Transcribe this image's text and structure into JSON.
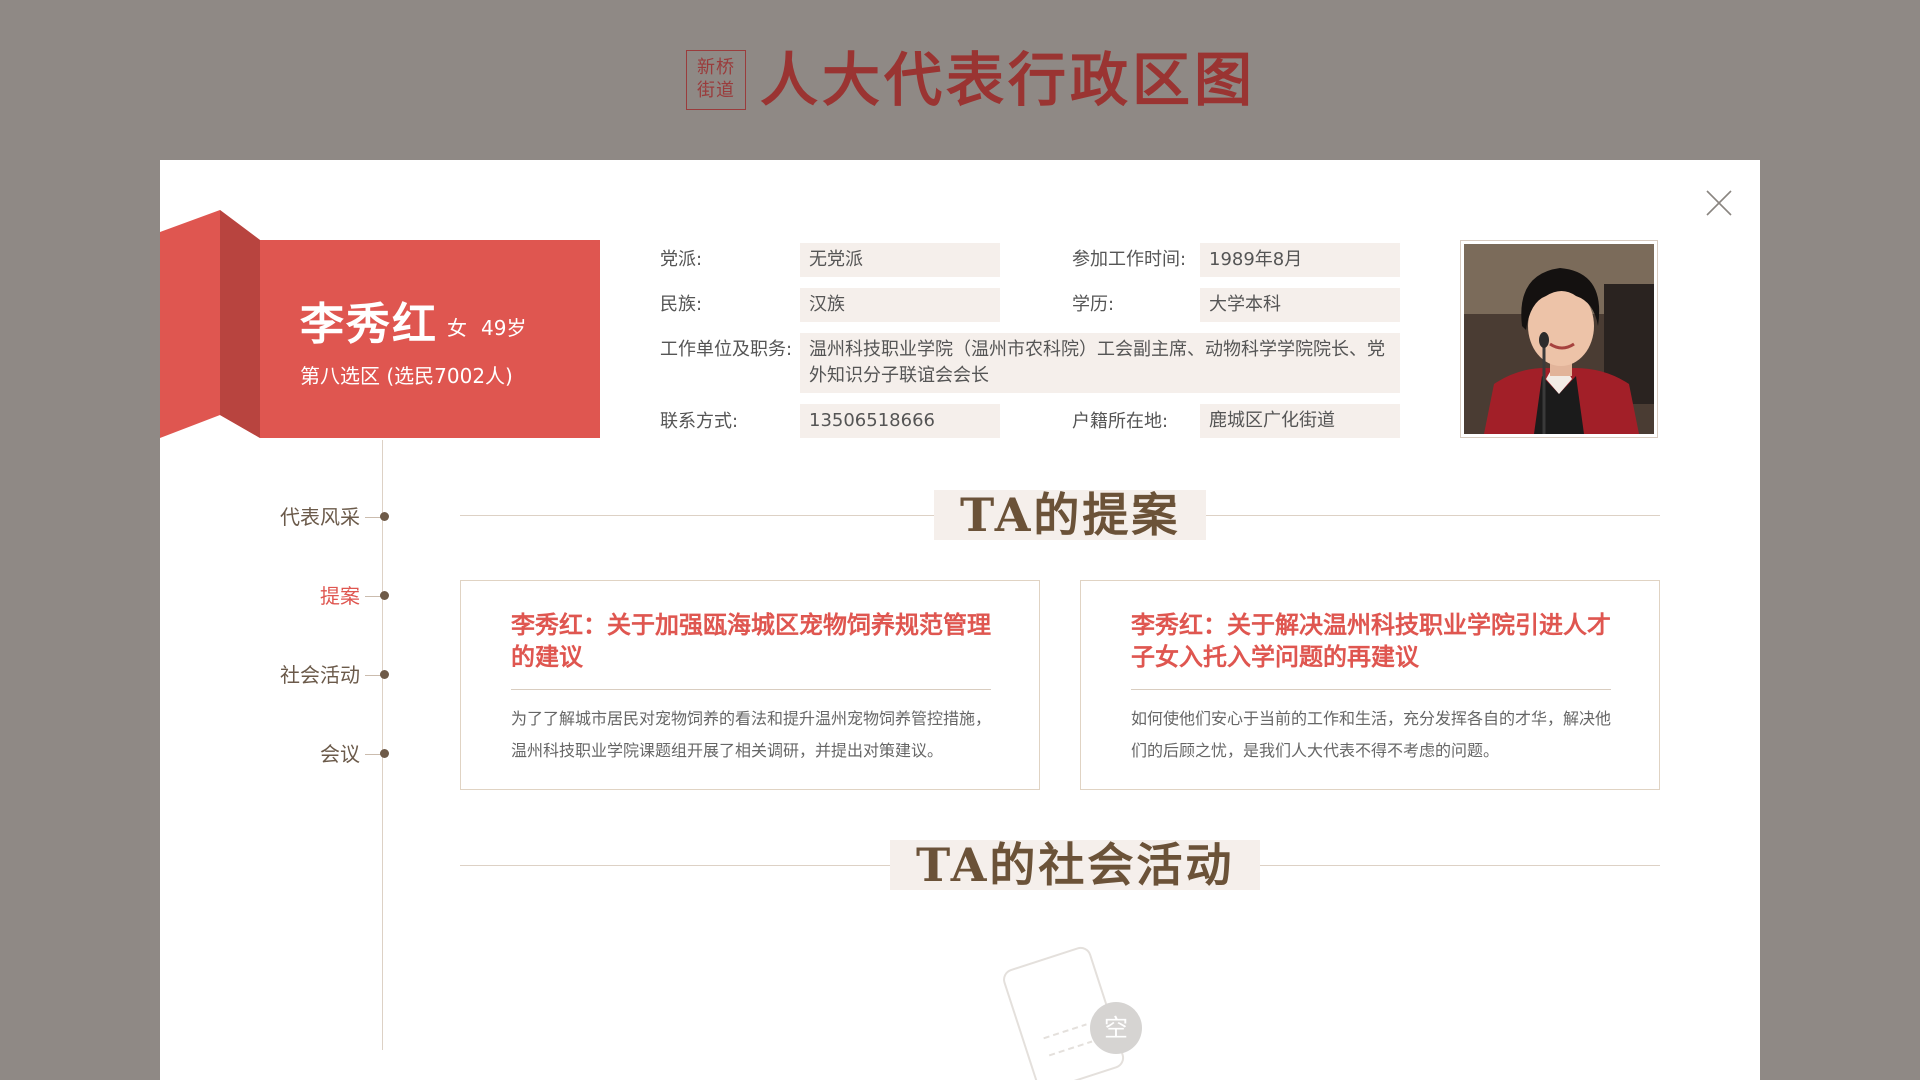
{
  "header": {
    "stamp_line1": "新桥",
    "stamp_line2": "街道",
    "title": "人大代表行政区图"
  },
  "profile": {
    "name": "李秀红",
    "gender": "女",
    "age": "49岁",
    "district": "第八选区 (选民7002人)",
    "fields": {
      "party_label": "党派:",
      "party_value": "无党派",
      "work_start_label": "参加工作时间:",
      "work_start_value": "1989年8月",
      "ethnicity_label": "民族:",
      "ethnicity_value": "汉族",
      "education_label": "学历:",
      "education_value": "大学本科",
      "employer_label": "工作单位及职务:",
      "employer_value": "温州科技职业学院（温州市农科院）工会副主席、动物科学学院院长、党外知识分子联谊会会长",
      "contact_label": "联系方式:",
      "contact_value": "13506518666",
      "residence_label": "户籍所在地:",
      "residence_value": "鹿城区广化街道"
    }
  },
  "nav": {
    "items": [
      {
        "label": "代表风采",
        "active": false
      },
      {
        "label": "提案",
        "active": true
      },
      {
        "label": "社会活动",
        "active": false
      },
      {
        "label": "会议",
        "active": false
      }
    ]
  },
  "proposals": {
    "section_title": "TA的提案",
    "cards": [
      {
        "title": "李秀红：关于加强瓯海城区宠物饲养规范管理的建议",
        "summary": "为了了解城市居民对宠物饲养的看法和提升温州宠物饲养管控措施，温州科技职业学院课题组开展了相关调研，并提出对策建议。"
      },
      {
        "title": "李秀红：关于解决温州科技职业学院引进人才子女入托入学问题的再建议",
        "summary": "如何使他们安心于当前的工作和生活，充分发挥各自的才华，解决他们的后顾之忧，是我们人大代表不得不考虑的问题。"
      }
    ]
  },
  "activities": {
    "section_title": "TA的社会活动",
    "empty_label": "空"
  },
  "colors": {
    "page_bg": "#8f8985",
    "accent_red": "#df5650",
    "header_red": "#9a3432",
    "field_bg": "#f5efeb",
    "brown_text": "#6b5238"
  },
  "icons": {
    "close": "close-icon",
    "empty": "empty-document-icon"
  }
}
